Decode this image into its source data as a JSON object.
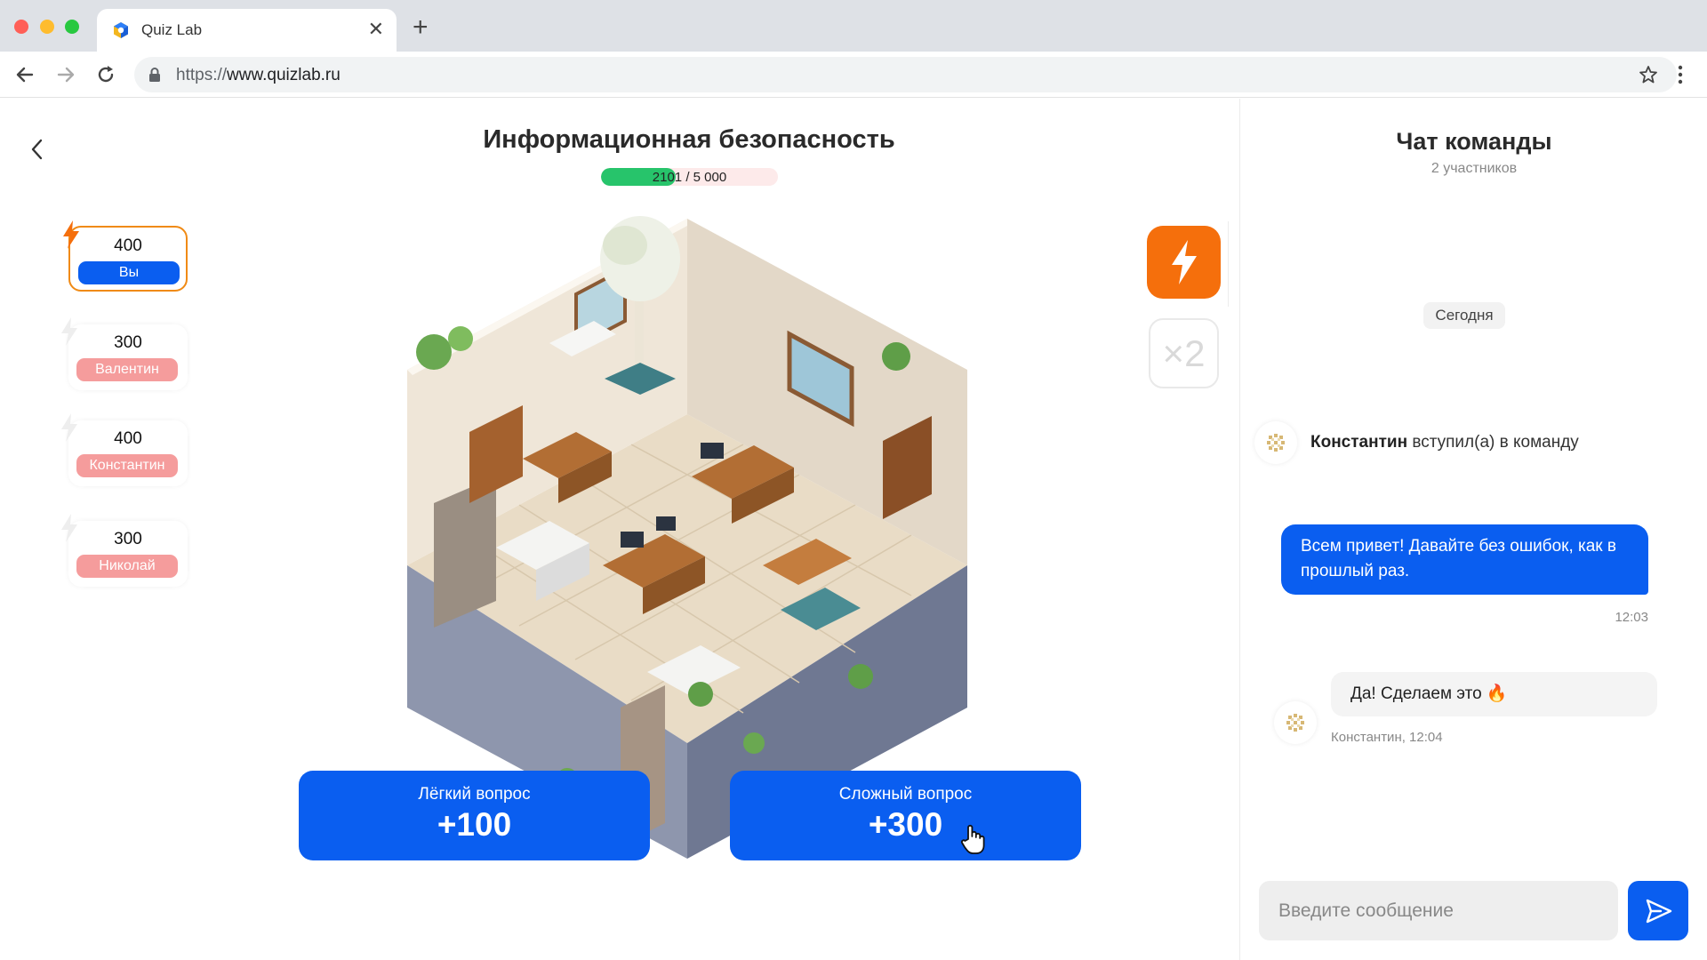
{
  "browser": {
    "tab_title": "Quiz Lab",
    "url_scheme": "https://",
    "url_host": "www.quizlab.ru"
  },
  "quiz": {
    "title": "Информационная безопасность",
    "progress_current": "2101",
    "progress_total": " / 5 000",
    "progress_fraction": 0.42
  },
  "players": [
    {
      "score": "400",
      "name": "Вы",
      "active": true
    },
    {
      "score": "300",
      "name": "Валентин",
      "active": false
    },
    {
      "score": "400",
      "name": "Константин",
      "active": false
    },
    {
      "score": "300",
      "name": "Николай",
      "active": false
    }
  ],
  "powerups": {
    "bolt_icon": "lightning-icon",
    "x2_label": "×2"
  },
  "questions": {
    "easy_label": "Лёгкий вопрос",
    "easy_points": "+100",
    "hard_label": "Сложный вопрос",
    "hard_points": "+300"
  },
  "chat": {
    "title": "Чат команды",
    "subtitle": "2 участников",
    "date_chip": "Сегодня",
    "system_user": "Константин",
    "system_text": " вступил(а) в команду",
    "outgoing_text": "Всем привет! Давайте без ошибок, как в прошлый раз.",
    "outgoing_time": "12:03",
    "incoming_text": "Да! Сделаем это 🔥",
    "incoming_meta": "Константин, 12:04",
    "input_placeholder": "Введите сообщение"
  },
  "colors": {
    "accent_blue": "#0a5ef0",
    "accent_orange": "#f56f0c",
    "progress_green": "#27c46b",
    "inactive_badge": "#f59c9c"
  }
}
